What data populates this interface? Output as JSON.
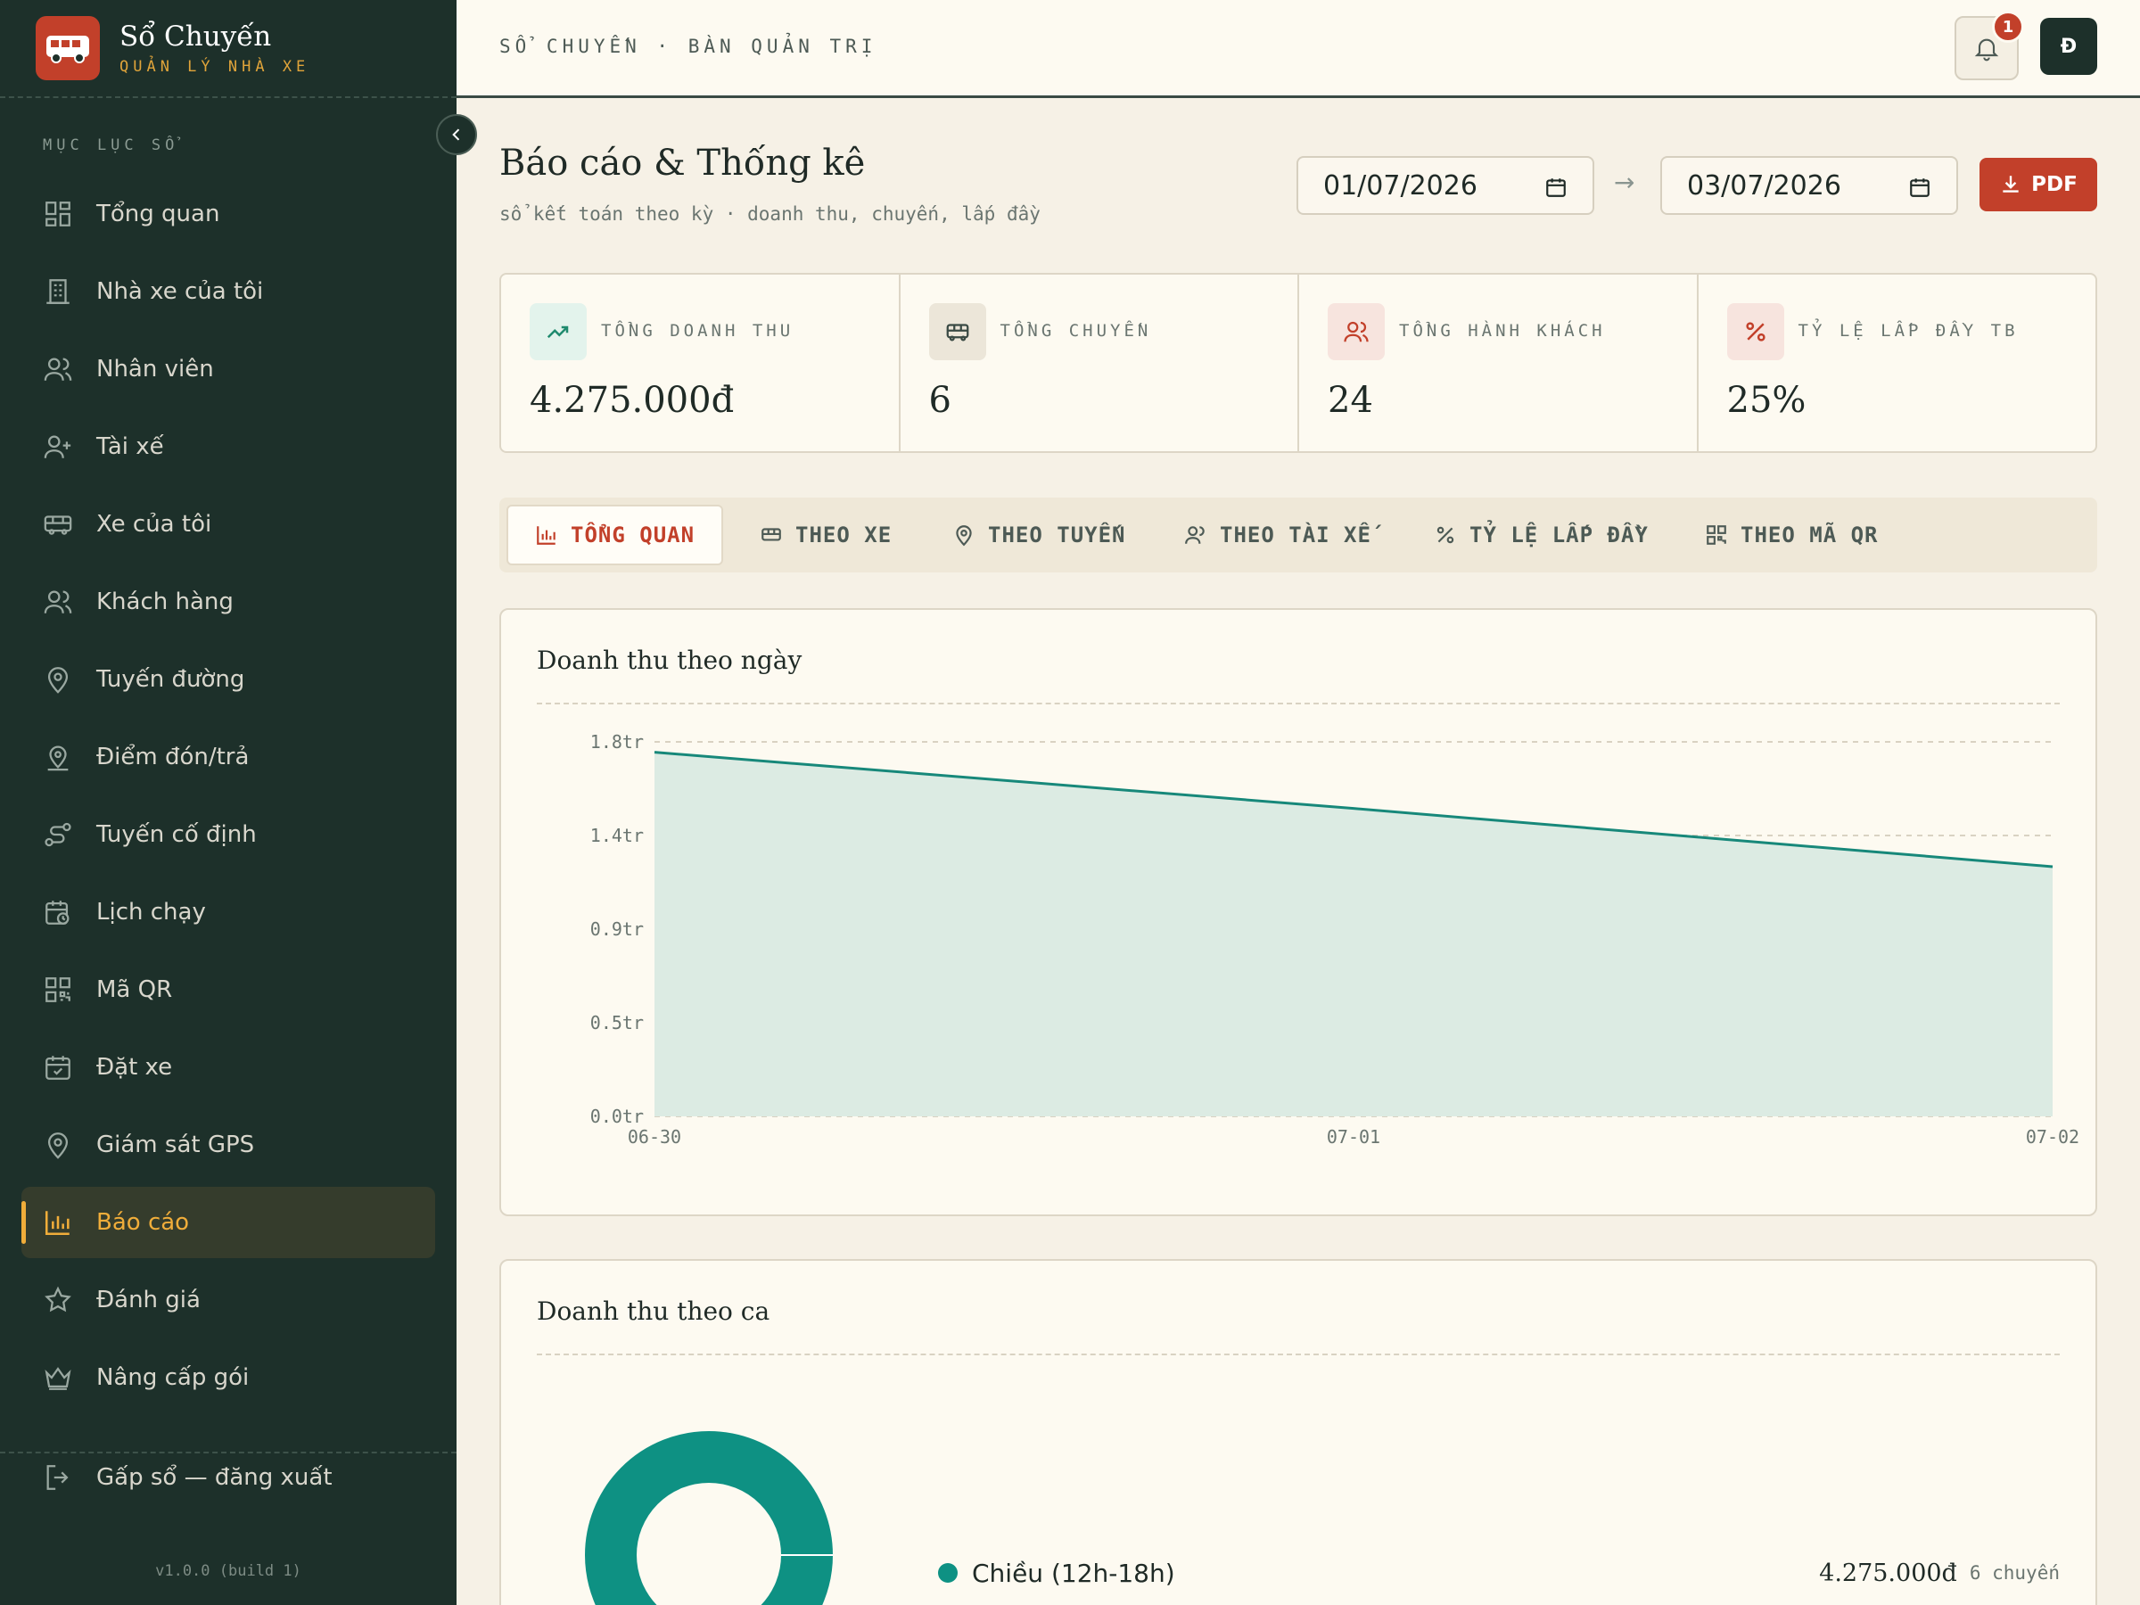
{
  "brand": {
    "title": "Sổ Chuyến",
    "subtitle": "QUẢN LÝ NHÀ XE"
  },
  "sidebar": {
    "section_label": "MỤC LỤC SỔ",
    "items": [
      {
        "label": "Tổng quan",
        "icon": "grid-icon"
      },
      {
        "label": "Nhà xe của tôi",
        "icon": "building-icon"
      },
      {
        "label": "Nhân viên",
        "icon": "users-icon"
      },
      {
        "label": "Tài xế",
        "icon": "user-plus-icon"
      },
      {
        "label": "Xe của tôi",
        "icon": "bus-icon"
      },
      {
        "label": "Khách hàng",
        "icon": "users-icon"
      },
      {
        "label": "Tuyến đường",
        "icon": "map-pin-icon"
      },
      {
        "label": "Điểm đón/trả",
        "icon": "user-pin-icon"
      },
      {
        "label": "Tuyến cố định",
        "icon": "route-icon"
      },
      {
        "label": "Lịch chạy",
        "icon": "calendar-clock-icon"
      },
      {
        "label": "Mã QR",
        "icon": "qr-icon"
      },
      {
        "label": "Đặt xe",
        "icon": "calendar-check-icon"
      },
      {
        "label": "Giám sát GPS",
        "icon": "map-pin-icon"
      },
      {
        "label": "Báo cáo",
        "icon": "bar-chart-icon",
        "active": true
      },
      {
        "label": "Đánh giá",
        "icon": "star-icon"
      },
      {
        "label": "Nâng cấp gói",
        "icon": "crown-icon"
      }
    ],
    "logout_label": "Gấp sổ — đăng xuất",
    "version": "v1.0.0 (build 1)"
  },
  "topbar": {
    "breadcrumb": "SỔ CHUYẾN · BÀN QUẢN TRỊ",
    "notification_count": "1",
    "avatar_initial": "Đ"
  },
  "page": {
    "title": "Báo cáo & Thống kê",
    "subtitle": "sổ kết toán theo kỳ · doanh thu, chuyến, lấp đầy",
    "date_from": "01/07/2026",
    "date_arrow": "→",
    "date_to": "03/07/2026",
    "pdf_label": "PDF"
  },
  "stats": [
    {
      "label": "TỔNG DOANH THU",
      "value": "4.275.000đ",
      "icon": "trending-up-icon",
      "color": "#1f8a6e",
      "bg": "#e3f3ec"
    },
    {
      "label": "TỔNG CHUYẾN",
      "value": "6",
      "icon": "bus-icon",
      "color": "#3a4a44",
      "bg": "#ece6d9"
    },
    {
      "label": "TỔNG HÀNH KHÁCH",
      "value": "24",
      "icon": "users-icon",
      "color": "#c2402a",
      "bg": "#f7e4de"
    },
    {
      "label": "TỶ LỆ LẤP ĐẦY TB",
      "value": "25%",
      "icon": "percent-icon",
      "color": "#c2402a",
      "bg": "#f7e4de"
    }
  ],
  "tabs": [
    {
      "label": "TỔNG QUAN",
      "icon": "bar-chart-icon",
      "active": true
    },
    {
      "label": "THEO XE",
      "icon": "bus-icon"
    },
    {
      "label": "THEO TUYẾN",
      "icon": "map-pin-icon"
    },
    {
      "label": "THEO TÀI XẾ",
      "icon": "users-icon"
    },
    {
      "label": "TỶ LỆ LẤP ĐẦY",
      "icon": "percent-icon"
    },
    {
      "label": "THEO MÃ QR",
      "icon": "qr-icon"
    }
  ],
  "revenue_card": {
    "title": "Doanh thu theo ngày"
  },
  "shift_card": {
    "title": "Doanh thu theo ca",
    "legend": [
      {
        "label": "Chiều (12h-18h)",
        "value": "4.275.000đ",
        "count": "6 chuyến",
        "color": "#0e9183"
      }
    ]
  },
  "chart_data": [
    {
      "type": "area",
      "title": "Doanh thu theo ngày",
      "x": [
        "06-30",
        "07-01",
        "07-02"
      ],
      "series": [
        {
          "values": [
            1.75,
            1.48,
            1.2
          ]
        }
      ],
      "yticks": [
        "0.0tr",
        "0.5tr",
        "0.9tr",
        "1.4tr",
        "1.8tr"
      ],
      "ytick_values": [
        0,
        0.45,
        0.9,
        1.35,
        1.8
      ],
      "ylim": [
        0,
        1.8
      ],
      "grid": true,
      "line_color": "#17887a",
      "fill_color": "#dcebe3"
    },
    {
      "type": "pie",
      "title": "Doanh thu theo ca",
      "categories": [
        "Chiều (12h-18h)"
      ],
      "values": [
        4275000
      ],
      "color": "#0e9183"
    }
  ]
}
